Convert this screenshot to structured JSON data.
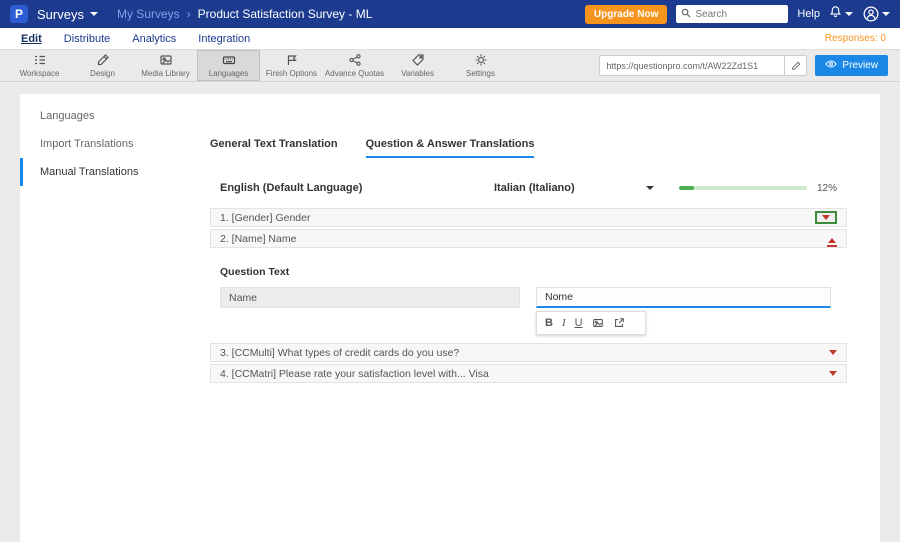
{
  "topbar": {
    "logo_letter": "P",
    "product_menu": "Surveys",
    "breadcrumb": {
      "parent": "My Surveys",
      "separator": "›",
      "current": "Product Satisfaction Survey - ML"
    },
    "upgrade_label": "Upgrade Now",
    "search_placeholder": "Search",
    "help_label": "Help"
  },
  "nav": {
    "items": [
      {
        "label": "Edit"
      },
      {
        "label": "Distribute"
      },
      {
        "label": "Analytics"
      },
      {
        "label": "Integration"
      }
    ],
    "responses": "Responses: 0"
  },
  "toolbar": {
    "items": [
      {
        "label": "Workspace"
      },
      {
        "label": "Design"
      },
      {
        "label": "Media Library"
      },
      {
        "label": "Languages"
      },
      {
        "label": "Finish Options"
      },
      {
        "label": "Advance Quotas"
      },
      {
        "label": "Variables"
      },
      {
        "label": "Settings"
      }
    ],
    "url_value": "https://questionpro.com/t/AW22Zd1S1",
    "preview_label": "Preview"
  },
  "sidebar": {
    "items": [
      {
        "label": "Languages"
      },
      {
        "label": "Import Translations"
      },
      {
        "label": "Manual Translations"
      }
    ]
  },
  "content": {
    "tabs": [
      {
        "label": "General Text Translation"
      },
      {
        "label": "Question & Answer Translations"
      }
    ],
    "source_language": "English (Default Language)",
    "target_language": "Italian (Italiano)",
    "progress_percent": "12%",
    "questions": [
      {
        "label": "1. [Gender] Gender"
      },
      {
        "label": "2. [Name] Name"
      },
      {
        "label": "3. [CCMulti] What types of credit cards do you use?"
      },
      {
        "label": "4. [CCMatri] Please rate your satisfaction level with... Visa"
      }
    ],
    "editor": {
      "section_label": "Question Text",
      "source_value": "Name",
      "target_value": "Nome",
      "fmt": {
        "bold": "B",
        "italic": "I",
        "underline": "U"
      }
    }
  }
}
